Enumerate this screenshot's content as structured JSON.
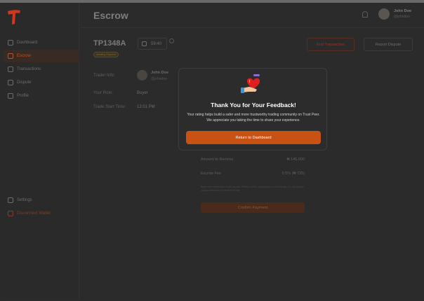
{
  "header": {
    "title": "Escrow",
    "user_name": "John Doe",
    "user_handle": "@johndoe"
  },
  "sidebar": {
    "items": [
      {
        "label": "Dashboard",
        "icon": "dashboard-icon"
      },
      {
        "label": "Escrow",
        "icon": "escrow-icon",
        "active": true
      },
      {
        "label": "Transactions",
        "icon": "transactions-icon"
      },
      {
        "label": "Dispute",
        "icon": "dispute-icon"
      },
      {
        "label": "Profile",
        "icon": "profile-icon"
      }
    ],
    "bottom": [
      {
        "label": "Settings",
        "icon": "settings-icon"
      },
      {
        "label": "Disconnect Wallet",
        "icon": "logout-icon"
      }
    ]
  },
  "trade": {
    "id": "TP1348A",
    "status": "Awaiting Payment",
    "timer": "59:40",
    "end_label": "End Transaction",
    "report_label": "Report Dispute",
    "trader_info_label": "Trader Info:",
    "trader_name": "John Doe",
    "trader_handle": "@johndoe",
    "role_label": "Your Role:",
    "role_value": "Buyer",
    "start_label": "Trade Start Time:",
    "start_value": "12:01 PM"
  },
  "summary": {
    "receive_label": "Amount to Receive",
    "receive_value": "₦ 145,000",
    "fee_label": "Escrow Fee",
    "fee_value": "0.5% (₦ 725)",
    "note": "Buyer has marked this trade as paid. Please confirm payment in your bank app. Do not release crypto unless you've received funds.",
    "confirm_label": "Confirm Payment"
  },
  "modal": {
    "title": "Thank You for Your Feedback!",
    "text": "Your rating helps build a safer and more trustworthy trading community on Trust Peer. We appreciate you taking the time to share your experience.",
    "button": "Return to Dashboard"
  },
  "colors": {
    "accent": "#c75214",
    "background": "#2b2b2b",
    "modal": "#2c2c2c"
  }
}
